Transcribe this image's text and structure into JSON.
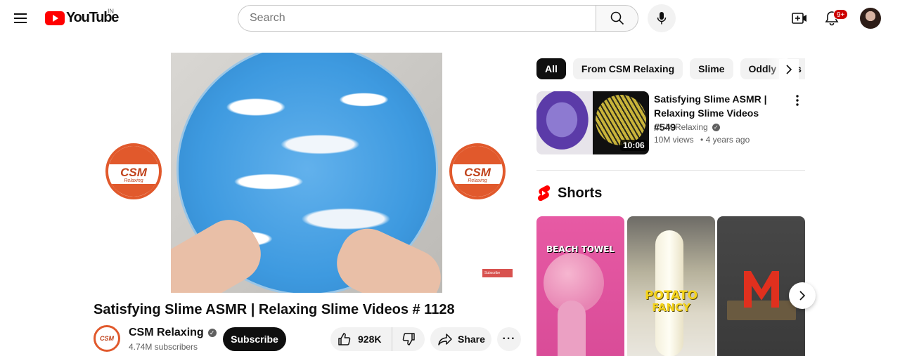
{
  "masthead": {
    "logo_text": "YouTube",
    "country_code": "IN",
    "search_placeholder": "Search",
    "notification_count": "9+"
  },
  "player": {
    "channel_logo_text": "CSM",
    "channel_logo_subtext": "Relaxing",
    "subscribe_watermark": "Subscribe"
  },
  "video": {
    "title": "Satisfying Slime ASMR | Relaxing Slime Videos # 1128",
    "channel_name": "CSM Relaxing",
    "channel_avatar_text": "CSM",
    "subscriber_count": "4.74M subscribers",
    "subscribe_label": "Subscribe",
    "like_count": "928K",
    "share_label": "Share"
  },
  "chips": [
    {
      "label": "All",
      "active": true
    },
    {
      "label": "From CSM Relaxing",
      "active": false
    },
    {
      "label": "Slime",
      "active": false
    },
    {
      "label": "Oddly satis",
      "active": false
    }
  ],
  "recommended": {
    "title": "Satisfying Slime ASMR | Relaxing Slime Videos #549",
    "channel": "CSM Relaxing",
    "views": "10M views",
    "age": "• 4 years ago",
    "duration": "10:06"
  },
  "shorts": {
    "heading": "Shorts",
    "items": [
      {
        "overlay": "BEACH TOWEL"
      },
      {
        "overlay_line1": "POTATO",
        "overlay_line2": "FANCY"
      },
      {
        "overlay": ""
      }
    ]
  },
  "colors": {
    "brand_red": "#ff0000",
    "text_primary": "#0f0f0f",
    "text_secondary": "#606060",
    "chip_bg": "#f2f2f2",
    "channel_orange": "#e1592c"
  }
}
